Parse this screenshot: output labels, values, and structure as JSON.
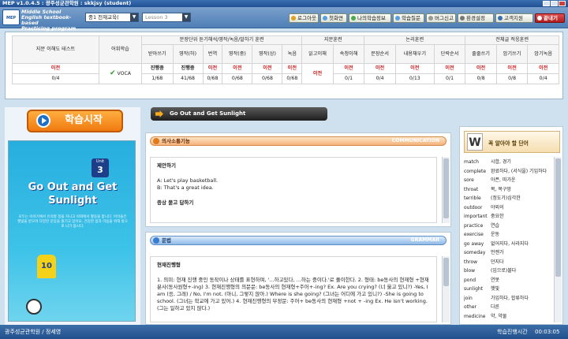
{
  "window": {
    "title": "MEP v1.0.4.5 : 광주성균관학원 : skkjsy (student)"
  },
  "toolbar": {
    "logo": "MEP",
    "program": [
      "Middle School",
      "English textbook-based",
      "Practicing program"
    ],
    "course_select": "중1 천재교육(",
    "lesson_select": "Lesson 3",
    "buttons": [
      "로그아웃",
      "첫화면",
      "나의학습정보",
      "학습질문",
      "버그신고",
      "환경설정",
      "고객지원",
      "끝내기"
    ]
  },
  "progress_table": {
    "group_headers": [
      "문장단위 듣기해석/영작/녹음/말하기 훈련",
      "지문훈련",
      "논리훈련",
      "전체글 적응훈련"
    ],
    "col_reading_test": "지문 이해도 테스트",
    "col_vocab": "어휘학습",
    "sub_headers": [
      "받아쓰기",
      "영작(하)",
      "번역",
      "영작(중)",
      "영작(상)",
      "녹음",
      "읽고이해",
      "속청이해",
      "문장순서",
      "내용채우기",
      "단락순서",
      "줄줄쓰기",
      "암기쓰기",
      "암기녹음"
    ],
    "row_status": [
      "이전",
      "",
      "진행중",
      "진행중",
      "이전",
      "이전",
      "이전",
      "이전",
      "이전",
      "이전",
      "이전",
      "이전",
      "이전",
      "이전",
      "이전",
      "이전"
    ],
    "row_scores": [
      "0/4",
      "VOCA",
      "1/68",
      "41/68",
      "0/68",
      "0/68",
      "0/68",
      "0/68",
      "",
      "0/1",
      "0/4",
      "0/13",
      "0/1",
      "0/8",
      "0/8",
      "0/4"
    ],
    "reading_merged": "이전"
  },
  "left": {
    "start_button": "학습시작",
    "book": {
      "unit_label": "Unit",
      "unit_number": "3",
      "title": "Go Out and Get Sunlight",
      "desc": "모두는 이야기에서 유의할 점을 지니고 야외에서 활동을 합니다. 아이들은 햇빛을 받으며 다양한 운동을 즐기고 있어요. 건강한 몸과 마음을 위해 밖으로 나가 봅시다.",
      "jersey": "10"
    }
  },
  "topic": {
    "title": "Go Out and Get Sunlight"
  },
  "communication": {
    "header": "의사소통기능",
    "tag": "COMMUNICATION",
    "heading": "제안하기",
    "line_a": "A: Let's play basketball.",
    "line_b": "B: That's a great idea.",
    "next_heading": "증상 묻고 답하기"
  },
  "grammar": {
    "header": "문법",
    "tag": "GRAMMAR",
    "heading": "현재진행형",
    "body": "1. 의미: 현재 진행 중인 동작이나 상태를 표현하며, '...하고있다, ...하는 중이다.'로 풀이한다. 2. 형태: be동사의 현재형 +현재분사(동사원형+-ing) 3. 현재진행형의 의문문: be동사의 현재형+주어+-ing? Ex. Are you crying? (너 울고 있니?) -Yes, I am (응, 그래) / No, I'm not. (아니, 그렇지 않아.) Where is she going? (그녀는 어디에 가고 있니?) -She is going to school. (그녀는 학교에 가고 있어.) 4. 현재진행형의 부정문: 주어+ be동사의 현재형 +not + -ing Ex. He isn't working. (그는 일하고 있지 않다.)"
  },
  "vocab": {
    "title": "꼭 알아야 할 단어",
    "items": [
      {
        "en": "match",
        "ko": "시합, 경기"
      },
      {
        "en": "complete",
        "ko": "완료하다, (서식을) 기입하다"
      },
      {
        "en": "sore",
        "ko": "아픈, 따가운"
      },
      {
        "en": "throat",
        "ko": "목, 목구멍"
      },
      {
        "en": "terrible",
        "ko": "(정도가)심각한"
      },
      {
        "en": "outdoor",
        "ko": "야외의"
      },
      {
        "en": "important",
        "ko": "중요한"
      },
      {
        "en": "practice",
        "ko": "연습"
      },
      {
        "en": "exercise",
        "ko": "운동"
      },
      {
        "en": "go away",
        "ko": "없어지다, 사라지다"
      },
      {
        "en": "someday",
        "ko": "언젠가"
      },
      {
        "en": "throw",
        "ko": "던지다"
      },
      {
        "en": "blow",
        "ko": "(입으로)불다"
      },
      {
        "en": "pond",
        "ko": "연못"
      },
      {
        "en": "sunlight",
        "ko": "햇빛"
      },
      {
        "en": "join",
        "ko": "가입하다, 합류하다"
      },
      {
        "en": "other",
        "ko": "다른"
      },
      {
        "en": "medicine",
        "ko": "약, 약물"
      }
    ]
  },
  "status": {
    "left": "광주성균관학원 / 정세영",
    "timer_label": "학습진행시간",
    "timer": "00:03:05"
  }
}
